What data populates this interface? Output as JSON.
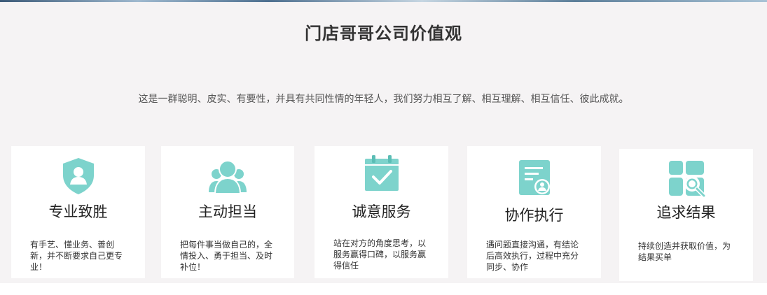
{
  "header": {
    "title": "门店哥哥公司价值观",
    "subtitle": "这是一群聪明、皮实、有要性，并具有共同性情的年轻人，我们努力相互了解、相互理解、相互信任、彼此成就。"
  },
  "colors": {
    "accent": "#7dd3cc",
    "card_bg": "#ffffff",
    "page_bg": "#f5f3f4"
  },
  "cards": [
    {
      "icon": "shield-user-icon",
      "title": "专业致胜",
      "desc": "有手艺、懂业务、善创新，并不断要求自己更专业！"
    },
    {
      "icon": "user-group-icon",
      "title": "主动担当",
      "desc": "把每件事当做自己的，全情投入、勇于担当、及时补位！"
    },
    {
      "icon": "calendar-check-icon",
      "title": "诚意服务",
      "desc": "站在对方的角度思考，以服务赢得口碑，以服务赢得信任"
    },
    {
      "icon": "certificate-icon",
      "title": "协作执行",
      "desc": "遇问题直接沟通，有结论后高效执行，过程中充分同步、协作"
    },
    {
      "icon": "search-result-icon",
      "title": "追求结果",
      "desc": "持续创造并获取价值，为结果买单"
    }
  ]
}
